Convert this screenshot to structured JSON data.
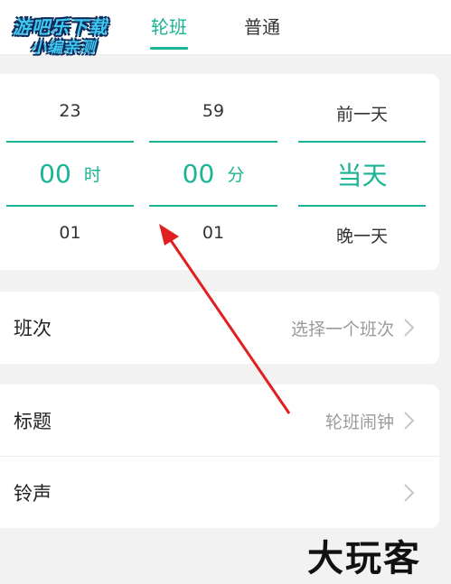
{
  "watermark": {
    "line1": "游吧乐下载",
    "line2": "小编亲测"
  },
  "tabs": [
    {
      "label": "轮班",
      "active": true
    },
    {
      "label": "普通",
      "active": false
    }
  ],
  "picker": {
    "hour": {
      "above": "23",
      "selected": "00",
      "unit": "时",
      "below": "01"
    },
    "minute": {
      "above": "59",
      "selected": "00",
      "unit": "分",
      "below": "01"
    },
    "day": {
      "above": "前一天",
      "selected": "当天",
      "below": "晚一天"
    }
  },
  "settings": {
    "shift": {
      "label": "班次",
      "value": "选择一个班次"
    },
    "title": {
      "label": "标题",
      "value": "轮班闹钟"
    },
    "ringtone": {
      "label": "铃声",
      "value": ""
    }
  },
  "corner_watermark": "大玩客",
  "colors": {
    "accent": "#1ab394",
    "annotation_arrow": "#e02020"
  },
  "icons": [
    "chevron-right-icon",
    "annotation-arrow"
  ]
}
